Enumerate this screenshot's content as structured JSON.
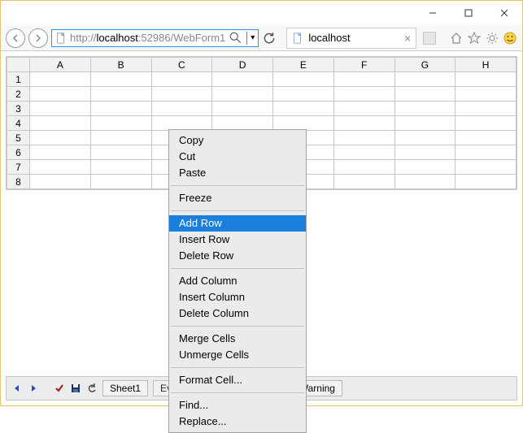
{
  "window": {
    "buttons": {
      "min": "min",
      "max": "max",
      "close": "close"
    }
  },
  "browser": {
    "url_prefix": "http://",
    "url_host": "localhost",
    "url_port_path": ":52986/WebForm1",
    "tab_title": "localhost"
  },
  "grid": {
    "columns": [
      "A",
      "B",
      "C",
      "D",
      "E",
      "F",
      "G",
      "H"
    ],
    "rows": [
      "1",
      "2",
      "3",
      "4",
      "5",
      "6",
      "7",
      "8"
    ],
    "selected_cell": {
      "row": 2,
      "col": 2
    }
  },
  "bottombar": {
    "sheet_tab": "Sheet1",
    "eval_button": "Eva",
    "warning_button": "Warning"
  },
  "context_menu": {
    "groups": [
      [
        "Copy",
        "Cut",
        "Paste"
      ],
      [
        "Freeze"
      ],
      [
        "Add Row",
        "Insert Row",
        "Delete Row"
      ],
      [
        "Add Column",
        "Insert Column",
        "Delete Column"
      ],
      [
        "Merge Cells",
        "Unmerge Cells"
      ],
      [
        "Format Cell..."
      ],
      [
        "Find...",
        "Replace..."
      ]
    ],
    "highlighted": "Add Row"
  }
}
